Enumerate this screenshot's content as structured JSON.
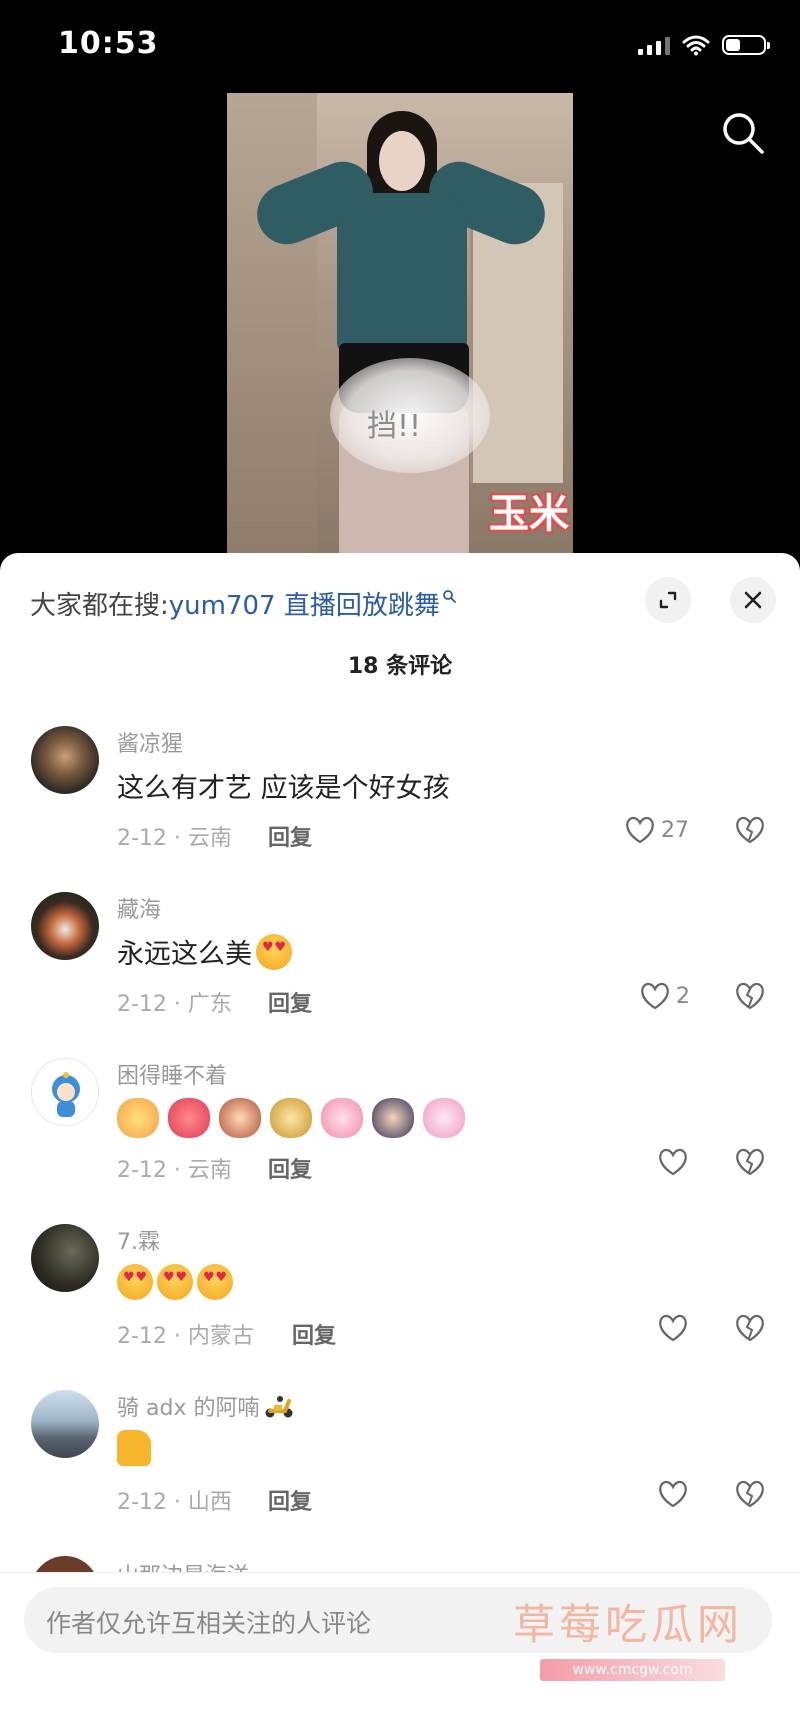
{
  "status_bar": {
    "time": "10:53"
  },
  "video": {
    "blur_text": "挡!!",
    "sticker_text": "玉米"
  },
  "sheet": {
    "hot_search_prefix": "大家都在搜:",
    "hot_search_query": "yum707 直播回放跳舞",
    "comment_count": "18 条评论",
    "reply_label": "回复"
  },
  "comments": [
    {
      "user": "酱凉猩",
      "text": "这么有才艺 应该是个好女孩",
      "meta": "2-12 · 云南",
      "likes": "27"
    },
    {
      "user": "藏海",
      "text": "永远这么美",
      "meta": "2-12 · 广东",
      "likes": "2"
    },
    {
      "user": "困得睡不着",
      "text": "",
      "meta": "2-12 · 云南",
      "likes": ""
    },
    {
      "user": "7.霖",
      "text": "",
      "meta": "2-12 · 内蒙古",
      "likes": ""
    },
    {
      "user": "骑 adx 的阿喃",
      "text": "",
      "meta": "2-12 · 山西",
      "likes": ""
    },
    {
      "user": "山那边是海洋",
      "text": "",
      "meta": "",
      "likes": ""
    }
  ],
  "input": {
    "placeholder": "作者仅允许互相关注的人评论"
  },
  "watermark": {
    "title": "草莓吃瓜网",
    "url": "www.cmcgw.com"
  },
  "colors": {
    "link": "#2a5caa",
    "heart": "#e0264a"
  }
}
